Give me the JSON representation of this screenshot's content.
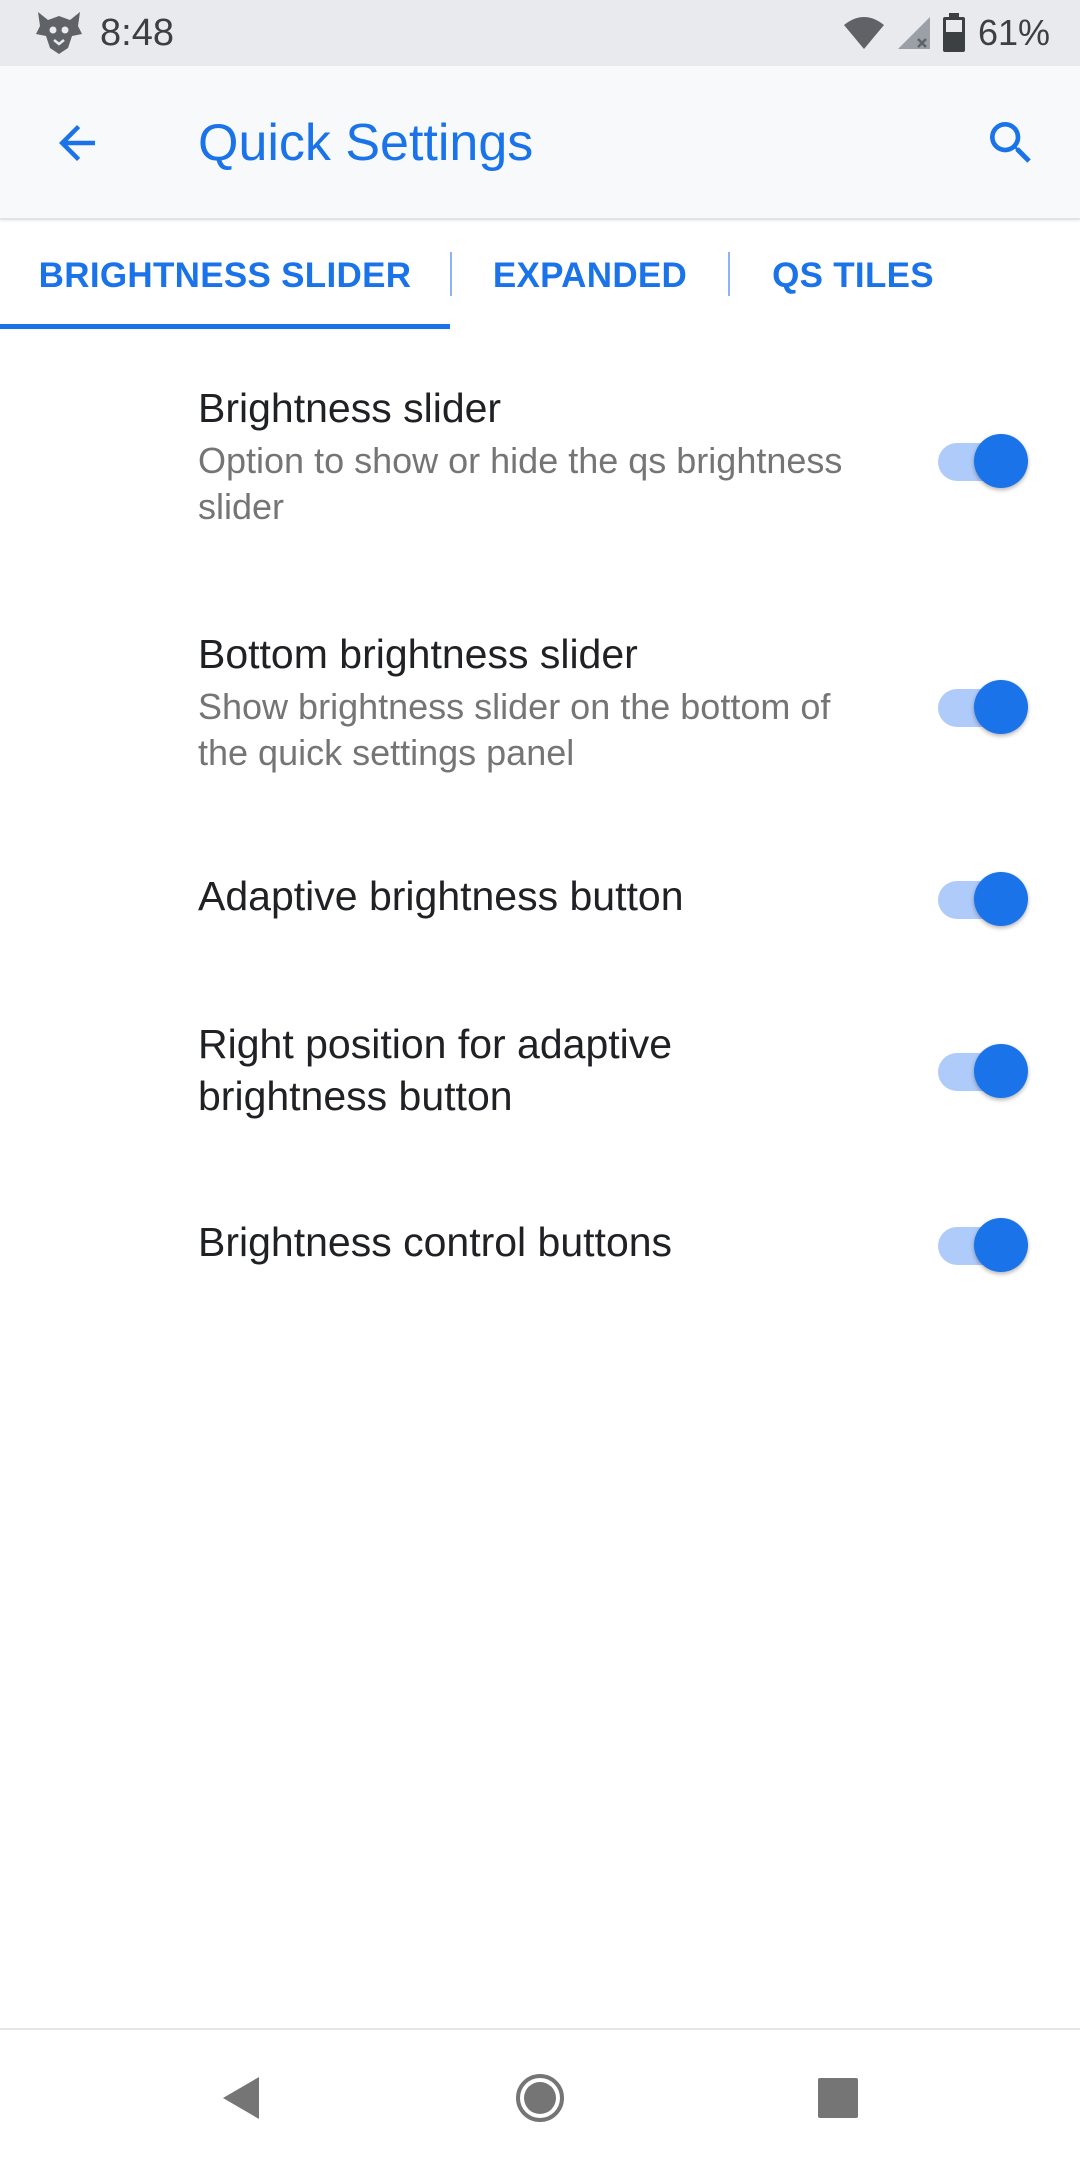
{
  "status_bar": {
    "time": "8:48",
    "battery": "61%",
    "icons": [
      "app-logo-icon",
      "wifi-icon",
      "cell-signal-icon",
      "battery-icon"
    ]
  },
  "app_bar": {
    "title": "Quick Settings",
    "back_icon": "arrow-back-icon",
    "search_icon": "search-icon"
  },
  "tabs": [
    {
      "label": "BRIGHTNESS SLIDER",
      "selected": true
    },
    {
      "label": "EXPANDED",
      "selected": false
    },
    {
      "label": "QS TILES",
      "selected": false
    }
  ],
  "settings": [
    {
      "title": "Brightness slider",
      "summary": "Option to show or hide the qs brightness slider",
      "enabled": true
    },
    {
      "title": "Bottom brightness slider",
      "summary": "Show brightness slider on the bottom of the quick settings panel",
      "enabled": true
    },
    {
      "title": "Adaptive brightness button",
      "summary": "",
      "enabled": true
    },
    {
      "title": "Right position for adaptive brightness button",
      "summary": "",
      "enabled": true
    },
    {
      "title": "Brightness control buttons",
      "summary": "",
      "enabled": true
    }
  ],
  "nav_bar": {
    "back_icon": "nav-back-icon",
    "home_icon": "nav-home-icon",
    "recents_icon": "nav-recents-icon"
  },
  "colors": {
    "accent": "#1a73e8",
    "switch_track": "#aecbfa",
    "status_bar_bg": "#e8eaed",
    "app_bar_bg": "#f8f9fa"
  }
}
